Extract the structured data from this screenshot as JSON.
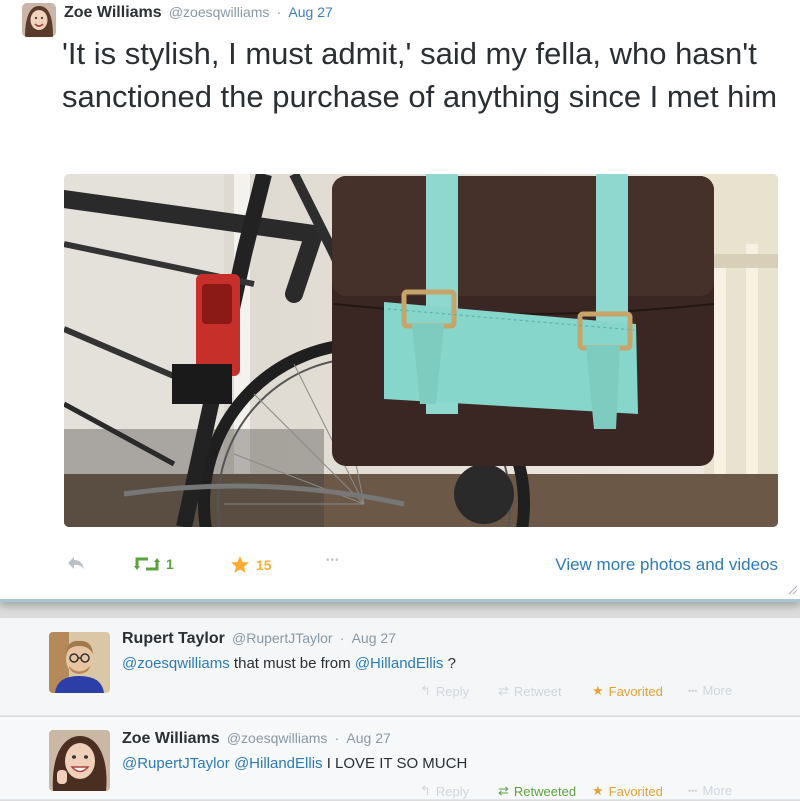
{
  "main_tweet": {
    "name": "Zoe Williams",
    "handle": "@zoesqwilliams",
    "separator": "·",
    "time": "Aug 27",
    "text": "'It is stylish, I must admit,' said my fella, who hasn't sanctioned the purchase of anything since I met him",
    "actions": {
      "reply_icon": "reply-icon",
      "retweet_icon": "retweet-icon",
      "retweet_count": "1",
      "favorite_icon": "star-icon",
      "favorite_count": "15",
      "more_icon": "more-dots-icon",
      "more_symbol": "•••",
      "view_more": "View more photos and videos"
    }
  },
  "replies": [
    {
      "name": "Rupert Taylor",
      "handle": "@RupertJTaylor",
      "separator": "·",
      "time": "Aug 27",
      "mention1": "@zoesqwilliams",
      "text_mid": " that must be from ",
      "mention2": "@HillandEllis",
      "text_end": " ?",
      "actions": {
        "reply": "Reply",
        "retweet": "Retweet",
        "favorite": "Favorited",
        "more": "More"
      }
    },
    {
      "name": "Zoe Williams",
      "handle": "@zoesqwilliams",
      "separator": "·",
      "time": "Aug 27",
      "mention1": "@RupertJTaylor",
      "mention2": "@HillandEllis",
      "text_end": " I LOVE IT SO MUCH",
      "actions": {
        "reply": "Reply",
        "retweet": "Retweeted",
        "favorite": "Favorited",
        "more": "More"
      }
    }
  ],
  "colors": {
    "link": "#2b7bb9",
    "retweet_green": "#5aa33c",
    "favorite_gold": "#ffac33",
    "meta_gray": "#8899a6"
  }
}
